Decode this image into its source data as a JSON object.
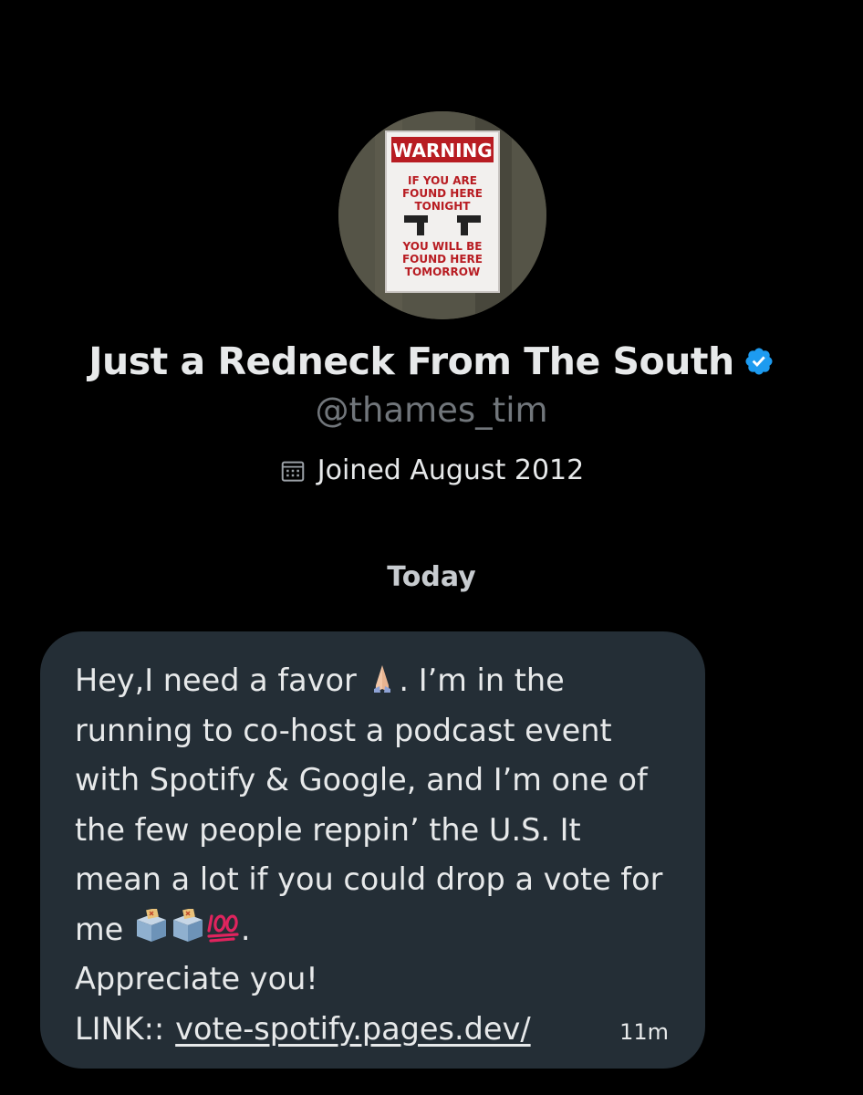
{
  "profile": {
    "avatar_sign": {
      "header": "WARNING",
      "line1": "IF YOU ARE",
      "line2": "FOUND HERE",
      "line3": "TONIGHT",
      "line4": "YOU WILL BE",
      "line5": "FOUND HERE",
      "line6": "TOMORROW"
    },
    "display_name": "Just a Redneck From The South",
    "handle": "@thames_tim",
    "joined": "Joined August 2012",
    "verified_color": "#1d9bf0"
  },
  "conversation": {
    "day_label": "Today",
    "message": {
      "text_part1": "Hey,I need a favor ",
      "text_part2": ". I’m in the running to co-host a podcast event with Spotify & Google, and I’m one of the few people reppin’ the U.S. It mean a lot if you could drop a vote for me ",
      "text_part3": ".\nAppreciate you!",
      "link_prefix": "LINK::",
      "link_text": "vote-spotify.pages.dev/",
      "timestamp": "11m",
      "emojis": [
        "folded-hands",
        "ballot-box",
        "ballot-box",
        "hundred-points"
      ]
    }
  },
  "colors": {
    "background": "#000000",
    "bubble": "#242e36",
    "text": "#e7e9ea",
    "muted": "#71767b"
  }
}
